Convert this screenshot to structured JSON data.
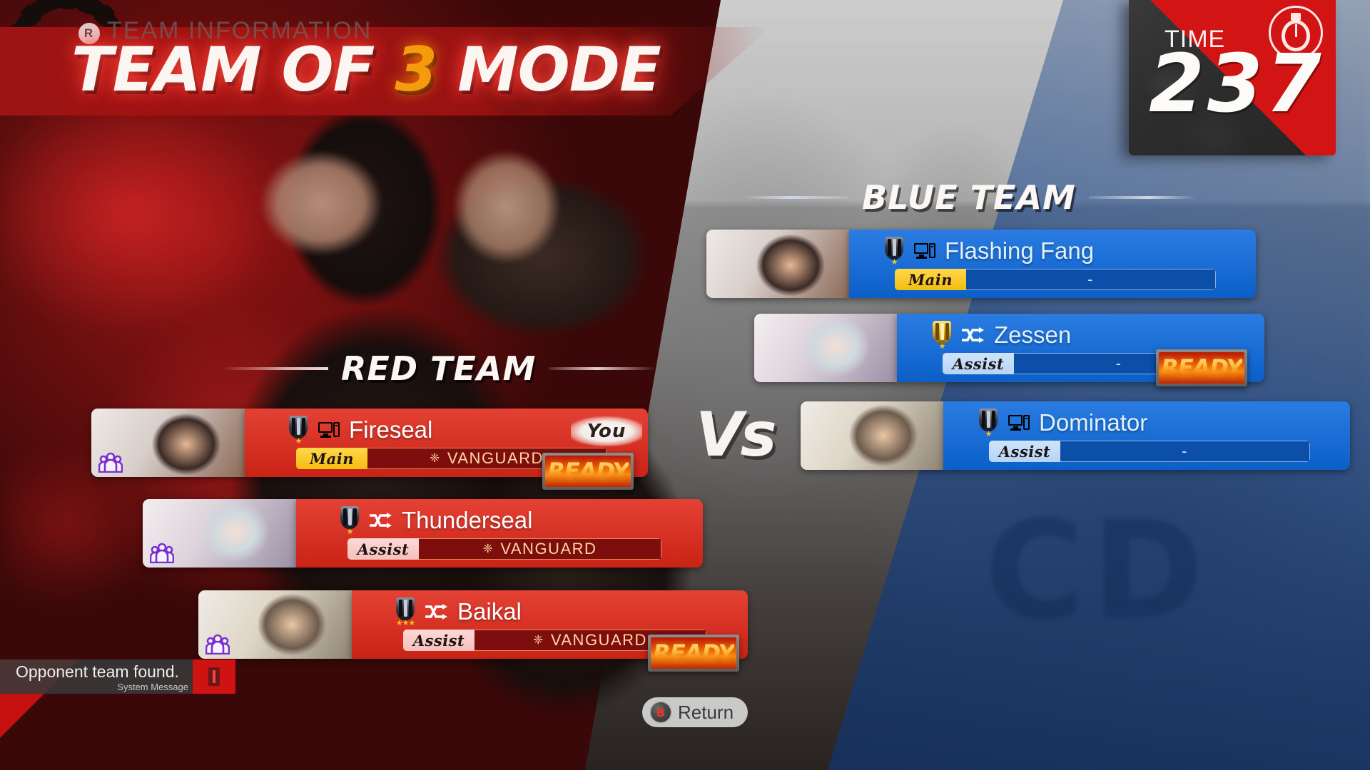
{
  "header": {
    "subtitle": "TEAM INFORMATION",
    "badge": "R",
    "title_part1": "TEAM OF ",
    "title_number": "3",
    "title_part2": " MODE"
  },
  "timer": {
    "label": "TIME",
    "value": "237",
    "icon": "stopwatch-icon"
  },
  "vs_label": "Vs",
  "red_team": {
    "heading": "RED TEAM",
    "color": "#e02718",
    "players": [
      {
        "name": "Fireseal",
        "platform_icon": "pc-icon",
        "select_icon": "",
        "rank_color": "#2b2b30",
        "rank_stars": "★",
        "slot_label": "Main",
        "slot_type": "main",
        "character": "VANGUARD",
        "character_emblem": "❈",
        "ready": "READY",
        "is_ready": true,
        "you_badge": "You",
        "is_you": true,
        "group_icon": "party-icon"
      },
      {
        "name": "Thunderseal",
        "platform_icon": "shuffle-icon",
        "select_icon": "shuffle-icon",
        "rank_color": "#2b2b30",
        "rank_stars": "★",
        "slot_label": "Assist",
        "slot_type": "assist",
        "character": "VANGUARD",
        "character_emblem": "❈",
        "ready": "",
        "is_ready": false,
        "you_badge": "",
        "is_you": false,
        "group_icon": "party-icon"
      },
      {
        "name": "Baikal",
        "platform_icon": "shuffle-icon",
        "select_icon": "shuffle-icon",
        "rank_color": "#2b2b30",
        "rank_stars": "★★★",
        "slot_label": "Assist",
        "slot_type": "assist",
        "character": "VANGUARD",
        "character_emblem": "❈",
        "ready": "READY",
        "is_ready": true,
        "you_badge": "",
        "is_you": false,
        "group_icon": "party-icon"
      }
    ]
  },
  "blue_team": {
    "heading": "BLUE TEAM",
    "color": "#0d6ade",
    "players": [
      {
        "name": "Flashing Fang",
        "platform_icon": "pc-icon",
        "select_icon": "",
        "rank_color": "#2b2b30",
        "rank_stars": "★",
        "slot_label": "Main",
        "slot_type": "main",
        "character": "-",
        "character_emblem": "",
        "ready": "",
        "is_ready": false,
        "you_badge": "",
        "is_you": false,
        "group_icon": ""
      },
      {
        "name": "Zessen",
        "platform_icon": "shuffle-icon",
        "select_icon": "shuffle-icon",
        "rank_color": "#d9a319",
        "rank_stars": "★",
        "slot_label": "Assist",
        "slot_type": "assist",
        "character": "-",
        "character_emblem": "",
        "ready": "READY",
        "is_ready": true,
        "you_badge": "",
        "is_you": false,
        "group_icon": ""
      },
      {
        "name": "Dominator",
        "platform_icon": "pc-icon",
        "select_icon": "",
        "rank_color": "#2b2b30",
        "rank_stars": "★",
        "slot_label": "Assist",
        "slot_type": "assist",
        "character": "-",
        "character_emblem": "",
        "ready": "",
        "is_ready": false,
        "you_badge": "",
        "is_you": false,
        "group_icon": ""
      }
    ]
  },
  "footer": {
    "return_key": "B",
    "return_label": "Return"
  },
  "system_message": {
    "text": "Opponent team found.",
    "subtitle": "System Message",
    "icon": "alert-icon"
  },
  "background": {
    "watermark": "CD"
  }
}
